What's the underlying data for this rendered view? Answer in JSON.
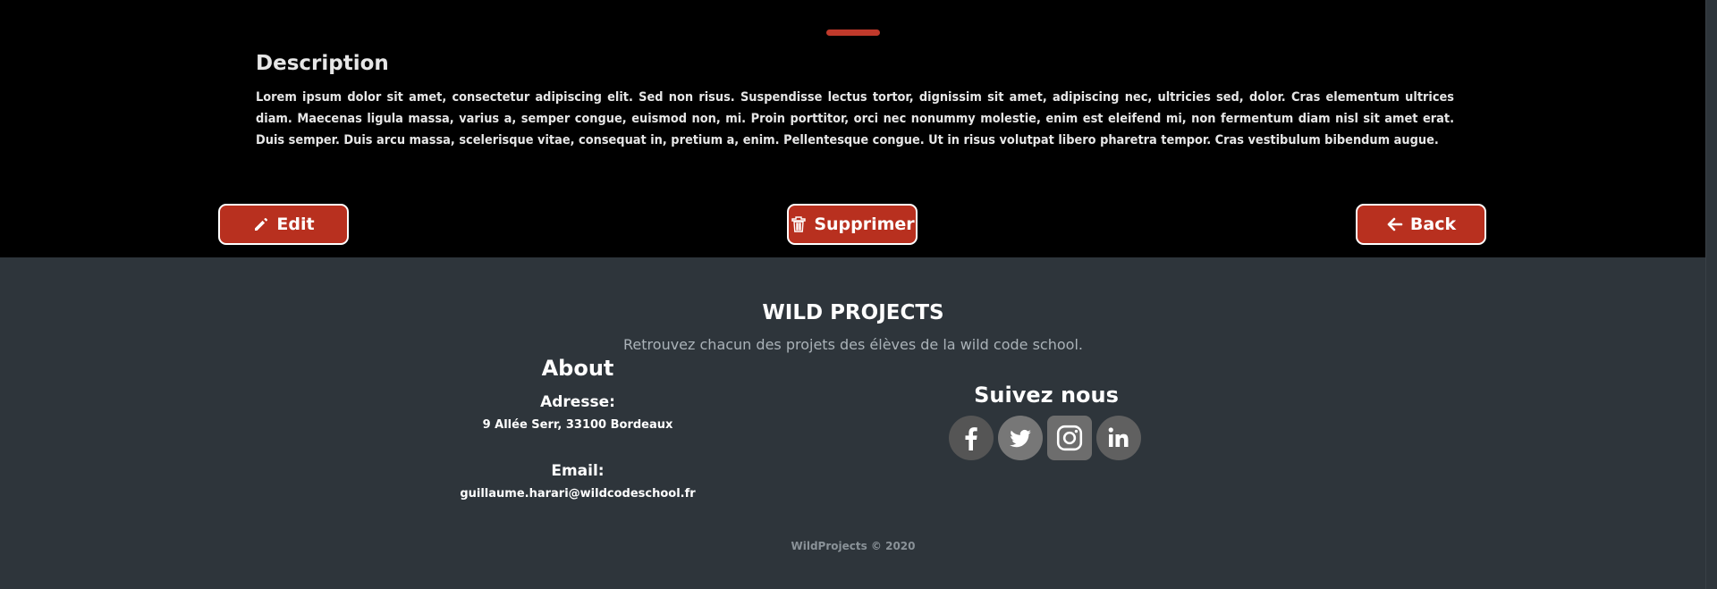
{
  "description": {
    "title": "Description",
    "text": "Lorem ipsum dolor sit amet, consectetur adipiscing elit. Sed non risus. Suspendisse lectus tortor, dignissim sit amet, adipiscing nec, ultricies sed, dolor. Cras elementum ultrices diam. Maecenas ligula massa, varius a, semper congue, euismod non, mi. Proin porttitor, orci nec nonummy molestie, enim est eleifend mi, non fermentum diam nisl sit amet erat. Duis semper. Duis arcu massa, scelerisque vitae, consequat in, pretium a, enim. Pellentesque congue. Ut in risus volutpat libero pharetra tempor. Cras vestibulum bibendum augue."
  },
  "actions": {
    "edit_label": "Edit",
    "delete_label": "Supprimer",
    "back_label": "Back"
  },
  "footer": {
    "title": "WILD PROJECTS",
    "tagline": "Retrouvez chacun des projets des élèves de la wild code school.",
    "about": {
      "heading": "About",
      "address_label": "Adresse:",
      "address": "9 Allée Serr, 33100 Bordeaux",
      "email_label": "Email:",
      "email": "guillaume.harari@wildcodeschool.fr"
    },
    "follow": {
      "heading": "Suivez nous",
      "icons": [
        "facebook-icon",
        "twitter-icon",
        "instagram-icon",
        "linkedin-icon"
      ]
    },
    "copyright": "WildProjects © 2020"
  },
  "colors": {
    "accent": "#c0392b",
    "button_bg": "#b8301f",
    "footer_bg": "#2e353b",
    "top_bg": "#000000"
  }
}
